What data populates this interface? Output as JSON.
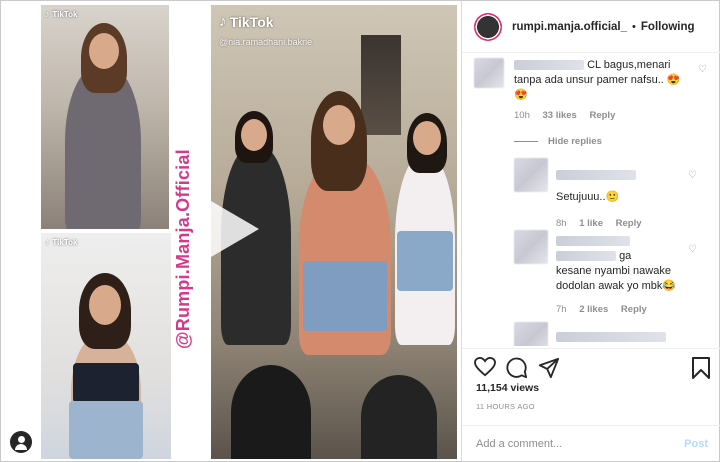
{
  "media": {
    "tiktok_label": "TikTok",
    "handle_top": "@nia.ramadhani.bakrie",
    "watermark": "@Rumpi.Manja.Official",
    "icons": {
      "play": "play-icon",
      "user": "user-icon",
      "tiktok": "tiktok-note-icon"
    }
  },
  "header": {
    "username": "rumpi.manja.official_",
    "separator": "•",
    "follow_status": "Following"
  },
  "comments": [
    {
      "text_line1": "CL bagus,menari",
      "text_line2": "tanpa ada unsur pamer nafsu.. 😍",
      "text_line3": "😍",
      "time": "10h",
      "likes": "33 likes",
      "reply": "Reply"
    }
  ],
  "hide_replies": "Hide replies",
  "replies": [
    {
      "text": "Setujuuu..🙂",
      "time": "8h",
      "likes": "1 like",
      "reply": "Reply"
    },
    {
      "text_line1": "ga",
      "text_line2": "kesane nyambi nawake",
      "text_line3": "dodolan awak yo mbk😂",
      "time": "7h",
      "likes": "2 likes",
      "reply": "Reply"
    }
  ],
  "footer": {
    "views": "11,154 views",
    "time_ago": "11 HOURS AGO",
    "add_comment_placeholder": "Add a comment...",
    "post_label": "Post"
  },
  "colors": {
    "watermark": "#d43a8c",
    "post_disabled": "#b3dbff",
    "meta_gray": "#8e8e8e"
  }
}
